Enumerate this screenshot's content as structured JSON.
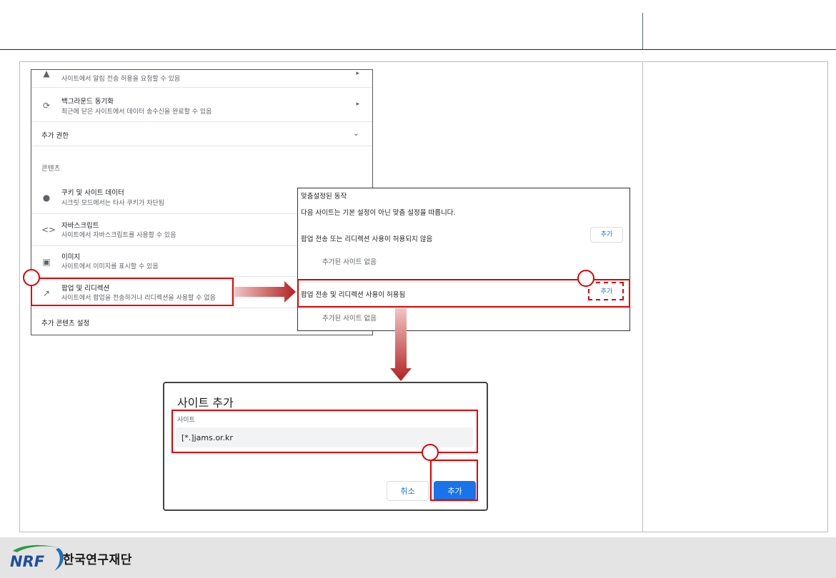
{
  "settings_panel": {
    "notification_sub": "사이트에서 알림 전송 허용을 요청할 수 있음",
    "background_sync_title": "백그라운드 동기화",
    "background_sync_sub": "최근에 닫은 사이트에서 데이터 송수신을 완료할 수 있음",
    "additional_permissions": "추가 권한",
    "content_heading": "콘텐츠",
    "cookies_title": "쿠키 및 사이트 데이터",
    "cookies_sub": "시크릿 모드에서는 타사 쿠키가 차단됨",
    "javascript_title": "자바스크립트",
    "javascript_sub": "사이트에서 자바스크립트를 사용할 수 있음",
    "images_title": "이미지",
    "images_sub": "사이트에서 이미지를 표시할 수 있음",
    "popups_title": "팝업 및 리디렉션",
    "popups_sub": "사이트에서 팝업을 전송하거나 리디렉션을 사용할 수 없음",
    "additional_content_settings": "추가 콘텐츠 설정"
  },
  "behavior_panel": {
    "title": "맞춤설정된 동작",
    "description": "다음 사이트는 기본 설정이 아닌 맞춤 설정을 따릅니다.",
    "blocked_label": "팝업 전송 또는 리디렉션 사용이 허용되지 않음",
    "blocked_add": "추가",
    "blocked_empty": "추가된 사이트 없음",
    "allowed_label": "팝업 전송 및 리디렉션 사용이 허용됨",
    "allowed_add": "추가",
    "allowed_empty": "추가된 사이트 없음"
  },
  "dialog": {
    "title": "사이트 추가",
    "field_label": "사이트",
    "site_value": "[*.]jams.or.kr",
    "cancel_label": "취소",
    "add_label": "추가"
  },
  "footer": {
    "logo_mark": "NRF",
    "org_name": "한국연구재단"
  },
  "colors": {
    "annotation": "#e00000",
    "accent": "#1a73e8",
    "arrow_top": "#f2c4c4",
    "arrow_bottom": "#b22222"
  }
}
